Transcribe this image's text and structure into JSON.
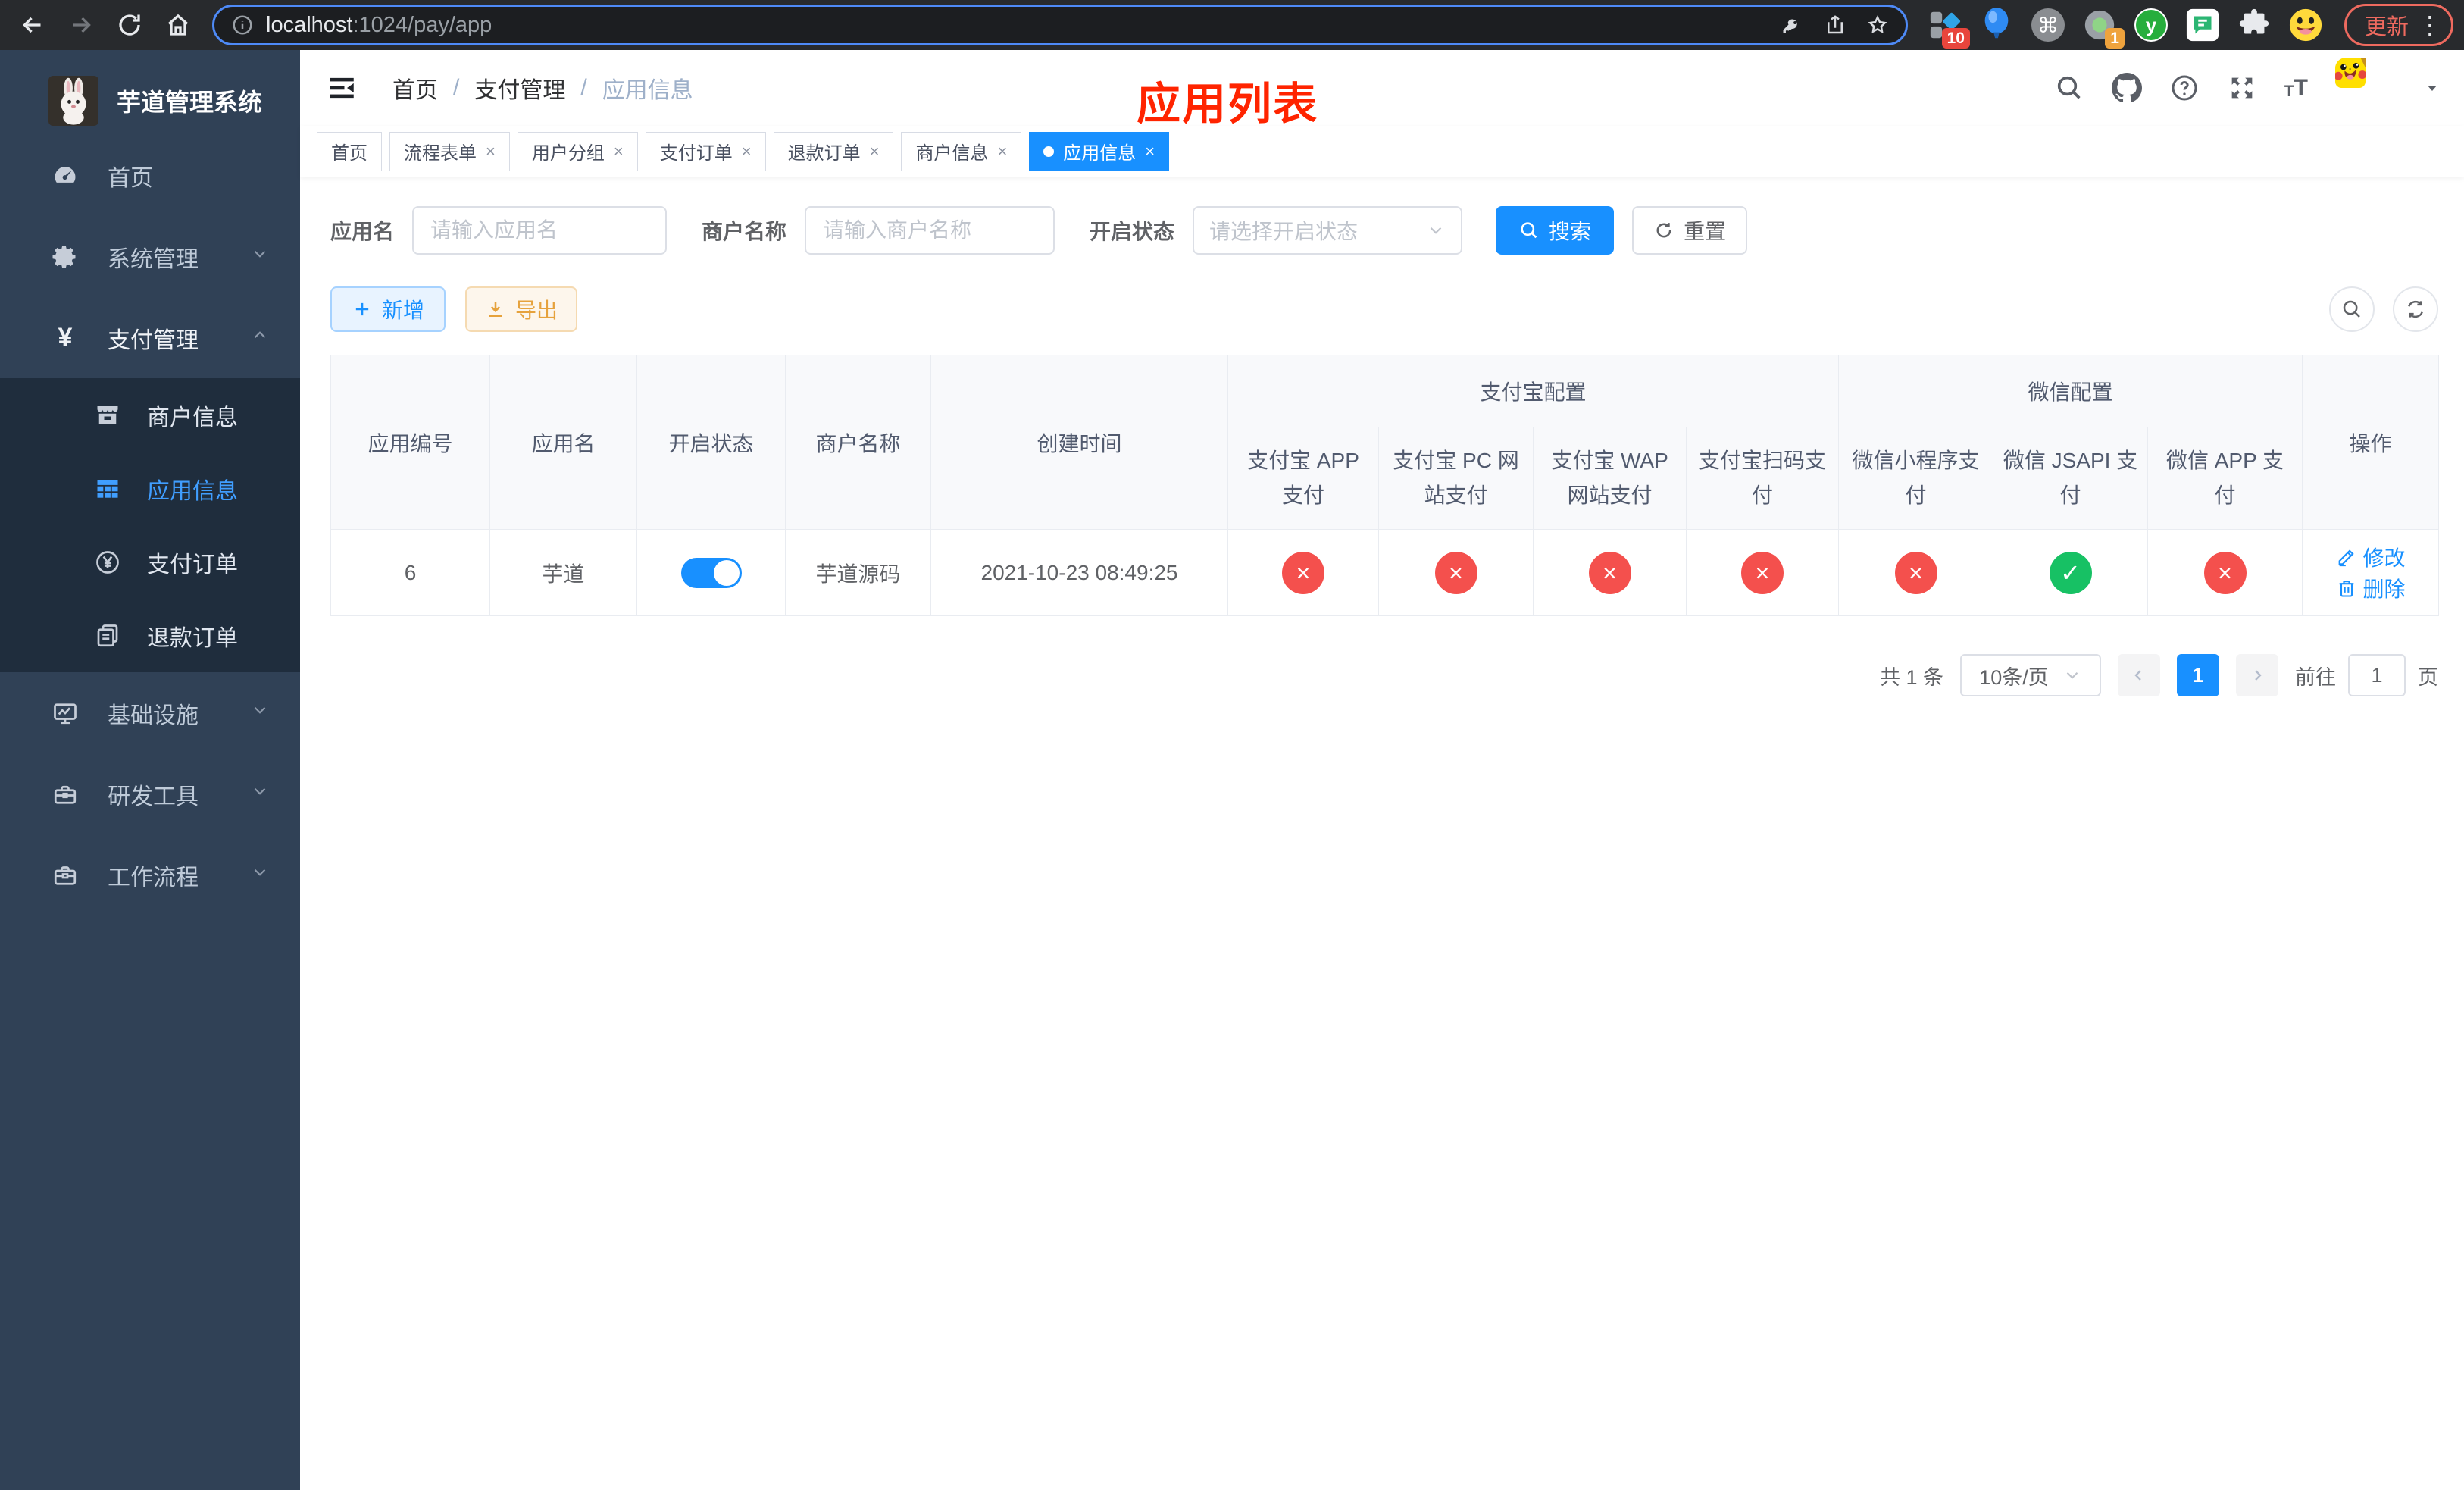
{
  "browser": {
    "url_host": "localhost",
    "url_rest": ":1024/pay/app",
    "ext_badge_blocks": "10",
    "ext_badge_record": "1",
    "update_label": "更新"
  },
  "sidebar": {
    "title": "芋道管理系统",
    "items": {
      "home": "首页",
      "system": "系统管理",
      "payment": "支付管理",
      "merchant": "商户信息",
      "appinfo": "应用信息",
      "payorder": "支付订单",
      "refund": "退款订单",
      "infra": "基础设施",
      "devtools": "研发工具",
      "workflow": "工作流程"
    }
  },
  "navbar": {
    "breadcrumb": [
      "首页",
      "支付管理",
      "应用信息"
    ],
    "separator": "/",
    "annotation": "应用列表"
  },
  "tabs": [
    {
      "label": "首页"
    },
    {
      "label": "流程表单"
    },
    {
      "label": "用户分组"
    },
    {
      "label": "支付订单"
    },
    {
      "label": "退款订单"
    },
    {
      "label": "商户信息"
    },
    {
      "label": "应用信息"
    }
  ],
  "filters": {
    "app_name_label": "应用名",
    "app_name_placeholder": "请输入应用名",
    "merchant_label": "商户名称",
    "merchant_placeholder": "请输入商户名称",
    "status_label": "开启状态",
    "status_placeholder": "请选择开启状态",
    "search_label": "搜索",
    "reset_label": "重置"
  },
  "toolbar": {
    "add_label": "新增",
    "export_label": "导出"
  },
  "table": {
    "columns": [
      "应用编号",
      "应用名",
      "开启状态",
      "商户名称",
      "创建时间"
    ],
    "group_alipay": "支付宝配置",
    "group_wechat": "微信配置",
    "alipay_columns": [
      "支付宝 APP 支付",
      "支付宝 PC 网站支付",
      "支付宝 WAP 网站支付",
      "支付宝扫码支付"
    ],
    "wechat_columns": [
      "微信小程序支付",
      "微信 JSAPI 支付",
      "微信 APP 支付"
    ],
    "actions_column": "操作",
    "rows": [
      {
        "id": "6",
        "name": "芋道",
        "enabled": true,
        "merchant": "芋道源码",
        "created": "2021-10-23 08:49:25",
        "alipay_status": [
          "no",
          "no",
          "no",
          "no"
        ],
        "wechat_status": [
          "no",
          "yes",
          "no"
        ],
        "edit_label": "修改",
        "delete_label": "删除"
      }
    ]
  },
  "pagination": {
    "total": "共 1 条",
    "page_size": "10条/页",
    "current_page": "1",
    "goto_label": "前往",
    "goto_value": "1",
    "page_suffix": "页"
  },
  "colors": {
    "accent_blue": "#1890ff",
    "active_menu_blue": "#409eff",
    "status_no_red": "#f4504d",
    "status_ok_green": "#17c164",
    "annotation_red": "#ff2400",
    "sidebar_bg": "#304156",
    "submenu_bg": "#1f2d3d"
  }
}
